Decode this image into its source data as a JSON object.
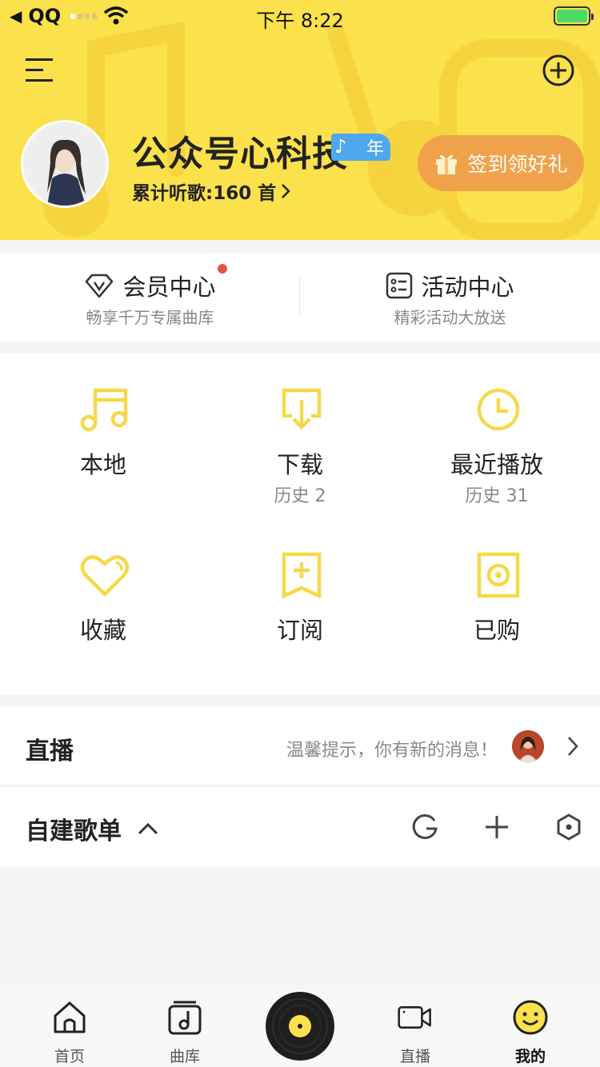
{
  "status_bar": {
    "back_app": "QQ",
    "time": "下午 8:22"
  },
  "header": {
    "menu_icon": "menu-icon",
    "add_icon": "plus-circle-icon",
    "username": "公众号心科技",
    "vip_badge": "年",
    "listen_count": "累计听歌:160 首",
    "checkin_label": "签到领好礼"
  },
  "centers": [
    {
      "title": "会员中心",
      "subtitle": "畅享千万专属曲库",
      "icon": "diamond-icon",
      "has_dot": true
    },
    {
      "title": "活动中心",
      "subtitle": "精彩活动大放送",
      "icon": "list-card-icon",
      "has_dot": false
    }
  ],
  "grid": [
    {
      "label": "本地",
      "sub": "",
      "icon": "music-note-icon"
    },
    {
      "label": "下载",
      "sub": "历史 2",
      "icon": "download-icon"
    },
    {
      "label": "最近播放",
      "sub": "历史 31",
      "icon": "clock-icon"
    },
    {
      "label": "收藏",
      "sub": "",
      "icon": "heart-icon"
    },
    {
      "label": "订阅",
      "sub": "",
      "icon": "bookmark-plus-icon"
    },
    {
      "label": "已购",
      "sub": "",
      "icon": "purchased-disc-icon"
    }
  ],
  "live": {
    "title": "直播",
    "tip": "温馨提示，你有新的消息！"
  },
  "playlist": {
    "title": "自建歌单"
  },
  "tabs": [
    {
      "label": "首页",
      "icon": "home-icon"
    },
    {
      "label": "曲库",
      "icon": "library-icon"
    },
    {
      "label": "直播",
      "icon": "video-icon"
    },
    {
      "label": "我的",
      "icon": "smiley-icon",
      "active": true
    }
  ],
  "colors": {
    "header_yellow": "#fbe14b",
    "accent_yellow": "#f5d94a",
    "checkin_orange": "#f0a24a",
    "vip_blue": "#4da8ef",
    "dot_red": "#e95545"
  }
}
